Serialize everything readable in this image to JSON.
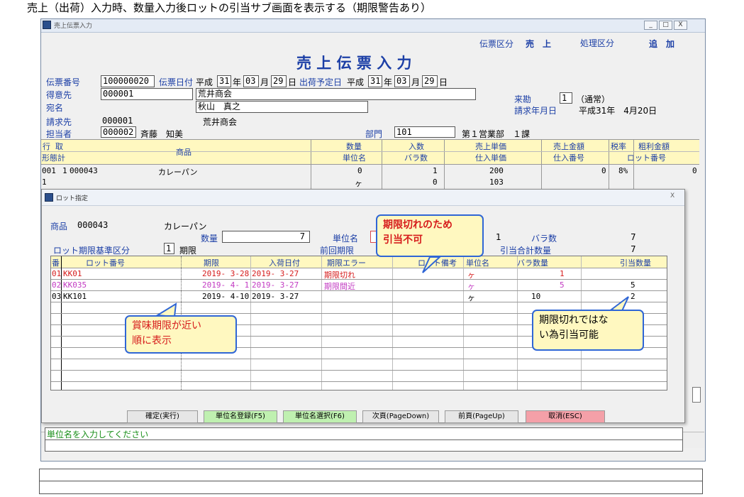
{
  "caption": "売上（出荷）入力時、数量入力後ロットの引当サブ画面を表示する（期限警告あり）",
  "window": {
    "title": "売上伝票入力",
    "controls": [
      "_",
      "□",
      "X"
    ]
  },
  "header": {
    "voucher_type_label": "伝票区分",
    "voucher_type_value": "売　上",
    "process_type_label": "処理区分",
    "process_type_value": "追　加",
    "form_title": "売 上 伝 票 入 力"
  },
  "fields": {
    "voucher_no_label": "伝票番号",
    "voucher_no": "100000020",
    "voucher_date_label": "伝票日付",
    "era1": "平成",
    "vd_year": "31",
    "vd_year_unit": "年",
    "vd_month": "03",
    "vd_month_unit": "月",
    "vd_day": "29",
    "vd_day_unit": "日",
    "ship_date_label": "出荷予定日",
    "era2": "平成",
    "sd_year": "31",
    "sd_year_unit": "年",
    "sd_month": "03",
    "sd_month_unit": "月",
    "sd_day": "29",
    "sd_day_unit": "日",
    "customer_label": "得意先",
    "customer_code": "000001",
    "customer_name": "荒井商会",
    "addressee_label": "宛名",
    "addressee_name": "秋山　真之",
    "billing_label": "請求先",
    "billing_code": "000001",
    "billing_name": "荒井商会",
    "staff_label": "担当者",
    "staff_code": "000002",
    "staff_name": "斉藤　知美",
    "visit_label": "来勘",
    "visit_value": "1",
    "visit_desc": "（通常）",
    "bill_date_label": "請求年月日",
    "bill_date_value": "平成31年　4月20日",
    "dept_label": "部門",
    "dept_code": "101",
    "dept_name": "第１営業部　１課"
  },
  "grid": {
    "headers_row1": [
      "行",
      "取",
      "商品",
      "数量",
      "入数",
      "売上単価",
      "売上金額",
      "税率",
      "粗利金額"
    ],
    "headers_row2": [
      "形態計",
      "単位名",
      "バラ数",
      "仕入単価",
      "仕入番号",
      "ロット番号"
    ],
    "row1": {
      "line": "001",
      "kind": "1",
      "code": "000043",
      "name": "カレーパン",
      "qty": "0",
      "irisu": "1",
      "price": "200",
      "amount": "0",
      "tax": "8%",
      "profit": "0"
    },
    "row2": {
      "kind": "1",
      "unit": "ヶ",
      "bara": "0",
      "cost": "103"
    }
  },
  "lot_dialog": {
    "title": "ロット指定",
    "close": "X",
    "product_label": "商品",
    "product_code": "000043",
    "product_name": "カレーパン",
    "qty_label": "数量",
    "qty_value": "7",
    "unit_label": "単位名",
    "irisu_value": "1",
    "bara_label": "バラ数",
    "bara_value": "7",
    "lot_basis_label": "ロット期限基準区分",
    "lot_basis_code": "1",
    "lot_basis_name": "期限",
    "prev_expiry_label": "前回期限",
    "alloc_total_label": "引当合計数量",
    "alloc_total_value": "7",
    "columns": [
      "番",
      "ロット番号",
      "期限",
      "入荷日付",
      "期限エラー",
      "ロット備考",
      "単位名",
      "バラ数量",
      "引当数量"
    ],
    "rows": [
      {
        "no": "01",
        "lot": "KK01",
        "expiry": "2019- 3-28",
        "arrival": "2019- 3-27",
        "error": "期限切れ",
        "memo": "",
        "unit": "ヶ",
        "bara": "1",
        "alloc": ""
      },
      {
        "no": "02",
        "lot": "KK035",
        "expiry": "2019- 4- 1",
        "arrival": "2019- 3-27",
        "error": "期限間近",
        "memo": "",
        "unit": "ヶ",
        "bara": "5",
        "alloc": "5"
      },
      {
        "no": "03",
        "lot": "KK101",
        "expiry": "2019- 4-10",
        "arrival": "2019- 3-27",
        "error": "",
        "memo": "",
        "unit": "ヶ",
        "bara": "10",
        "alloc": "2"
      }
    ],
    "buttons": {
      "confirm": "確定(実行)",
      "unit_register": "単位名登録(F5)",
      "unit_select": "単位名選択(F6)",
      "next_page": "次頁(PageDown)",
      "prev_page": "前頁(PageUp)",
      "cancel": "取消(ESC)"
    },
    "status_message": "単位名を入力してください"
  },
  "callouts": {
    "expired": "期限切れのため\n引当不可",
    "order": "賞味期限が近い\n順に表示",
    "allocatable": "期限切れではな\nい為引当可能"
  },
  "colors": {
    "label_blue": "#1c3fa6",
    "expired_red": "#d61c1c",
    "near_expiry_pink": "#c23ac2",
    "callout_fill": "#fff8c0",
    "callout_border": "#2f66d6",
    "btn_green": "#bff0b0",
    "btn_pink": "#f4a0a8"
  }
}
